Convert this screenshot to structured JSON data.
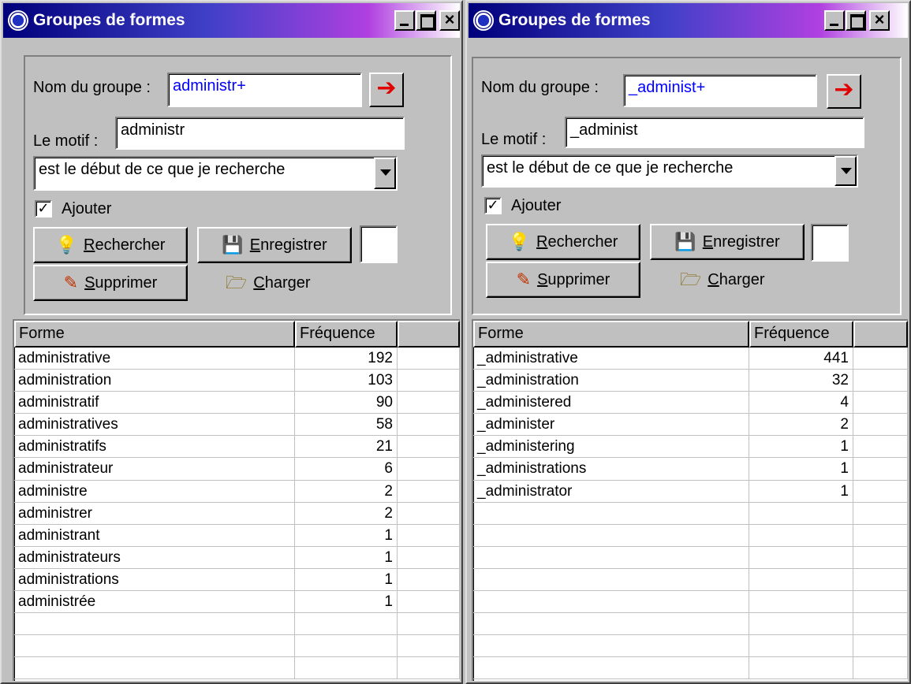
{
  "windows": [
    {
      "title": "Groupes de formes",
      "group_label": "Nom du groupe :",
      "group_value": "administr+",
      "pattern_label": "Le motif :",
      "pattern_value": "administr",
      "mode_value": "est le début de ce que je recherche",
      "add_label": "Ajouter",
      "add_checked": true,
      "buttons": {
        "search": {
          "pre": "",
          "u": "R",
          "post": "echercher"
        },
        "save": {
          "pre": "",
          "u": "E",
          "post": "nregistrer"
        },
        "delete": {
          "pre": "",
          "u": "S",
          "post": "upprimer"
        },
        "load": {
          "pre": "",
          "u": "C",
          "post": "harger"
        }
      },
      "columns": [
        "Forme",
        "Fréquence"
      ],
      "rows": [
        [
          "administrative",
          "192"
        ],
        [
          "administration",
          "103"
        ],
        [
          "administratif",
          "90"
        ],
        [
          "administratives",
          "58"
        ],
        [
          "administratifs",
          "21"
        ],
        [
          "administrateur",
          "6"
        ],
        [
          "administre",
          "2"
        ],
        [
          "administrer",
          "2"
        ],
        [
          "administrant",
          "1"
        ],
        [
          "administrateurs",
          "1"
        ],
        [
          "administrations",
          "1"
        ],
        [
          "administrée",
          "1"
        ]
      ]
    },
    {
      "title": "Groupes de formes",
      "group_label": "Nom du groupe :",
      "group_value": "_administ+",
      "pattern_label": "Le motif :",
      "pattern_value": "_administ",
      "mode_value": "est le début de ce que je recherche",
      "add_label": "Ajouter",
      "add_checked": true,
      "buttons": {
        "search": {
          "pre": "",
          "u": "R",
          "post": "echercher"
        },
        "save": {
          "pre": "",
          "u": "E",
          "post": "nregistrer"
        },
        "delete": {
          "pre": "",
          "u": "S",
          "post": "upprimer"
        },
        "load": {
          "pre": "",
          "u": "C",
          "post": "harger"
        }
      },
      "columns": [
        "Forme",
        "Fréquence"
      ],
      "rows": [
        [
          "_administrative",
          "441"
        ],
        [
          "_administration",
          "32"
        ],
        [
          "_administered",
          "4"
        ],
        [
          "_administer",
          "2"
        ],
        [
          "_administering",
          "1"
        ],
        [
          "_administrations",
          "1"
        ],
        [
          "_administrator",
          "1"
        ]
      ]
    }
  ],
  "icons": {
    "window": "app-circle-icon",
    "minimize": "minimize-icon",
    "maximize": "maximize-icon",
    "close": "close-icon",
    "go": "red-arrow-icon",
    "search": "lightbulb-icon",
    "save": "save-icon",
    "delete": "eraser-icon",
    "load": "open-folder-icon"
  },
  "colors": {
    "titlebar_start": "#00007b",
    "titlebar_end": "#b040e0",
    "field_text_blue": "#0000ff",
    "arrow_red": "#e00000"
  }
}
